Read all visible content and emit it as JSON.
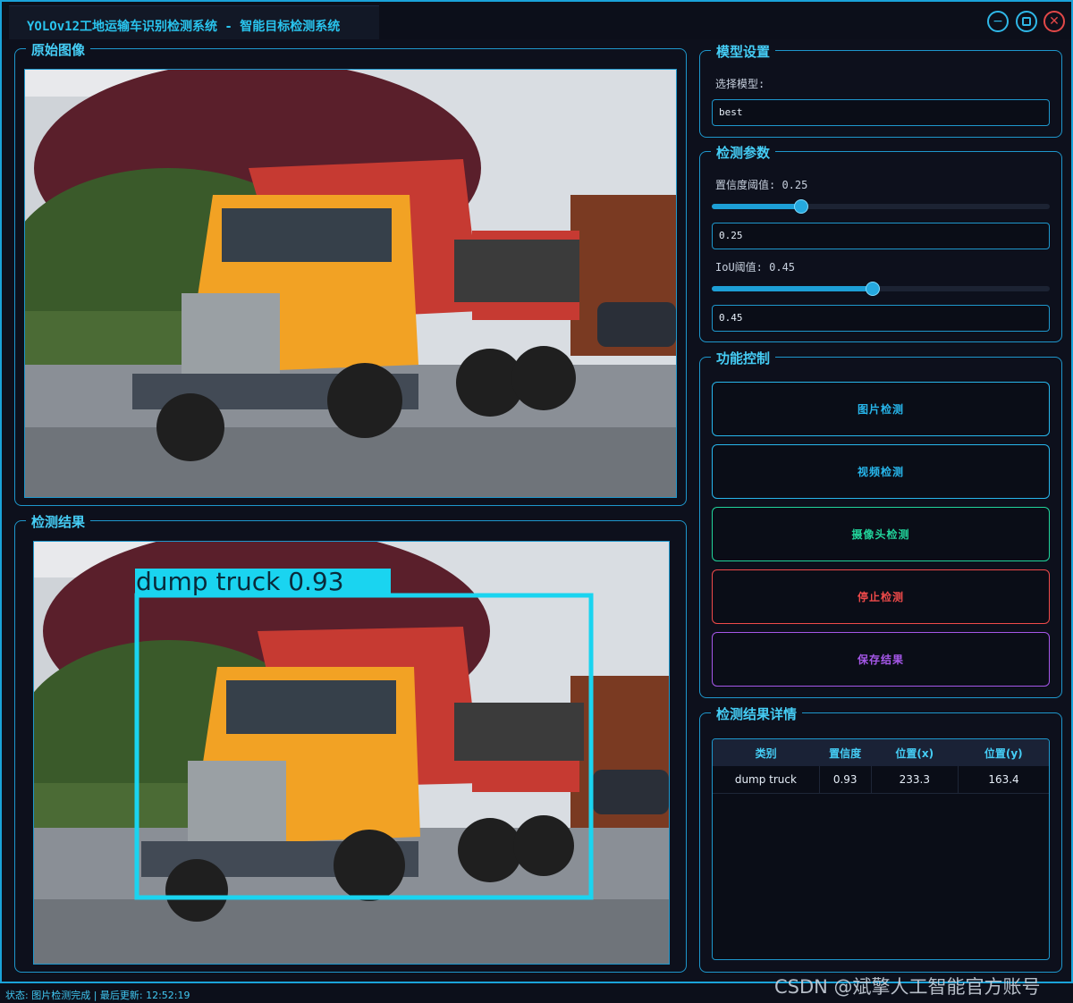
{
  "window": {
    "title": "YOLOv12工地运输车识别检测系统 - 智能目标检测系统",
    "minimize_icon": "minimize-icon",
    "maximize_icon": "maximize-icon",
    "close_icon": "close-icon"
  },
  "original_panel": {
    "title": "原始图像",
    "image": "dump-truck-photo"
  },
  "result_panel": {
    "title": "检测结果",
    "image": "dump-truck-photo",
    "detection_label": "dump truck 0.93",
    "box_color": "#1ad4f0"
  },
  "model_settings": {
    "title": "模型设置",
    "select_label": "选择模型:",
    "selected_model": "best"
  },
  "detect_params": {
    "title": "检测参数",
    "conf_label": "置信度阈值: 0.25",
    "conf_value": "0.25",
    "conf_fraction": 0.25,
    "iou_label": "IoU阈值: 0.45",
    "iou_value": "0.45",
    "iou_fraction": 0.45
  },
  "controls": {
    "title": "功能控制",
    "buttons": [
      {
        "label": "图片检测",
        "color": "#27b6ec"
      },
      {
        "label": "视频检测",
        "color": "#27b6ec"
      },
      {
        "label": "摄像头检测",
        "color": "#21d39a"
      },
      {
        "label": "停止检测",
        "color": "#ef4a4a"
      },
      {
        "label": "保存结果",
        "color": "#a557e8"
      }
    ]
  },
  "results_details": {
    "title": "检测结果详情",
    "columns": [
      "类别",
      "置信度",
      "位置(x)",
      "位置(y)"
    ],
    "rows": [
      [
        "dump truck",
        "0.93",
        "233.3",
        "163.4"
      ]
    ]
  },
  "status_bar": {
    "text": "状态: 图片检测完成 | 最后更新: 12:52:19"
  },
  "watermark": "CSDN @斌擎人工智能官方账号",
  "colors": {
    "accent": "#1e97cc",
    "title": "#45cdf5",
    "background": "#0d101c"
  }
}
